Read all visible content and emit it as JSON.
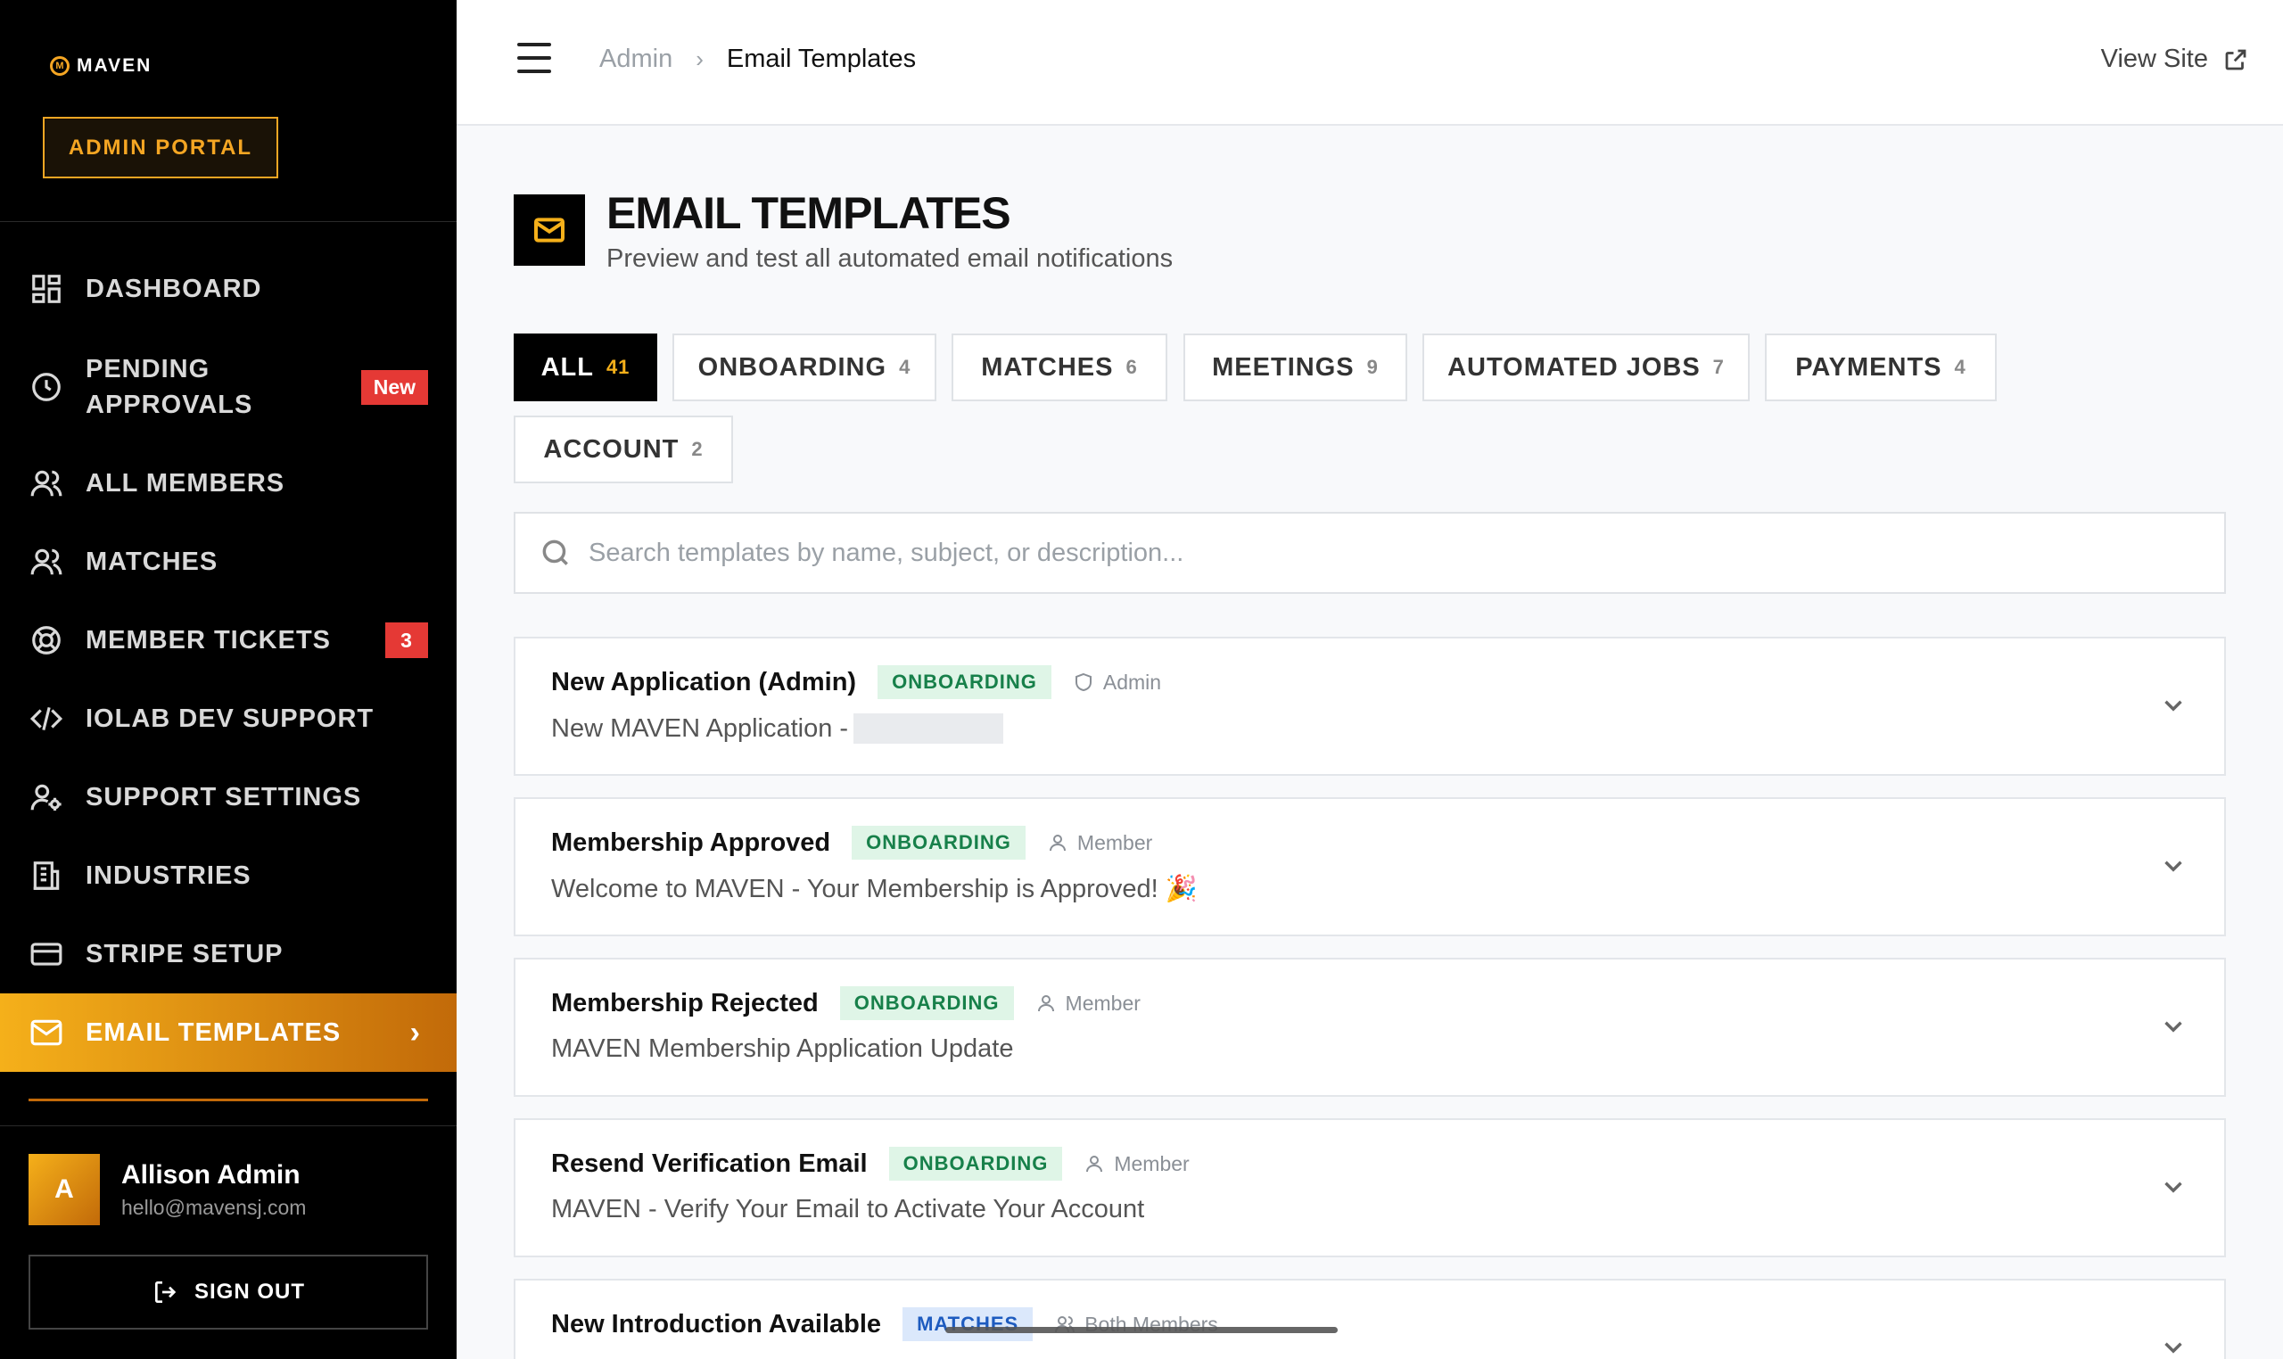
{
  "brand": {
    "name": "MAVEN",
    "mark": "M",
    "portal_label": "ADMIN PORTAL",
    "accent": "#f5b01a"
  },
  "sidebar": {
    "items": [
      {
        "label": "DASHBOARD",
        "icon": "dashboard-icon"
      },
      {
        "label": "PENDING",
        "label2": "APPROVALS",
        "icon": "clock-icon",
        "badge": "New"
      },
      {
        "label": "ALL MEMBERS",
        "icon": "users-icon"
      },
      {
        "label": "MATCHES",
        "icon": "users-icon"
      },
      {
        "label": "MEMBER TICKETS",
        "icon": "lifebuoy-icon",
        "badge": "3"
      },
      {
        "label": "IOLAB DEV SUPPORT",
        "icon": "code-icon"
      },
      {
        "label": "SUPPORT SETTINGS",
        "icon": "user-gear-icon"
      },
      {
        "label": "INDUSTRIES",
        "icon": "building-icon"
      },
      {
        "label": "STRIPE SETUP",
        "icon": "credit-card-icon"
      },
      {
        "label": "EMAIL TEMPLATES",
        "icon": "mail-icon",
        "active": true
      }
    ],
    "user": {
      "initial": "A",
      "name": "Allison Admin",
      "email": "hello@mavensj.com"
    },
    "signout_label": "SIGN OUT"
  },
  "header": {
    "breadcrumb": [
      "Admin",
      "Email Templates"
    ],
    "view_site_label": "View Site"
  },
  "page": {
    "title": "EMAIL TEMPLATES",
    "subtitle": "Preview and test all automated email notifications"
  },
  "tabs": [
    {
      "label": "ALL",
      "count": "41",
      "active": true
    },
    {
      "label": "ONBOARDING",
      "count": "4"
    },
    {
      "label": "MATCHES",
      "count": "6"
    },
    {
      "label": "MEETINGS",
      "count": "9"
    },
    {
      "label": "AUTOMATED JOBS",
      "count": "7"
    },
    {
      "label": "PAYMENTS",
      "count": "4"
    },
    {
      "label": "ACCOUNT",
      "count": "2"
    }
  ],
  "search": {
    "placeholder": "Search templates by name, subject, or description..."
  },
  "templates": [
    {
      "name": "New Application (Admin)",
      "category": "ONBOARDING",
      "audience": "Admin",
      "subject": "New MAVEN Application -"
    },
    {
      "name": "Membership Approved",
      "category": "ONBOARDING",
      "audience": "Member",
      "subject": "Welcome to MAVEN - Your Membership is Approved! 🎉"
    },
    {
      "name": "Membership Rejected",
      "category": "ONBOARDING",
      "audience": "Member",
      "subject": "MAVEN Membership Application Update"
    },
    {
      "name": "Resend Verification Email",
      "category": "ONBOARDING",
      "audience": "Member",
      "subject": "MAVEN - Verify Your Email to Activate Your Account"
    },
    {
      "name": "New Introduction Available",
      "category": "MATCHES",
      "audience": "Both Members",
      "subject": ""
    }
  ]
}
